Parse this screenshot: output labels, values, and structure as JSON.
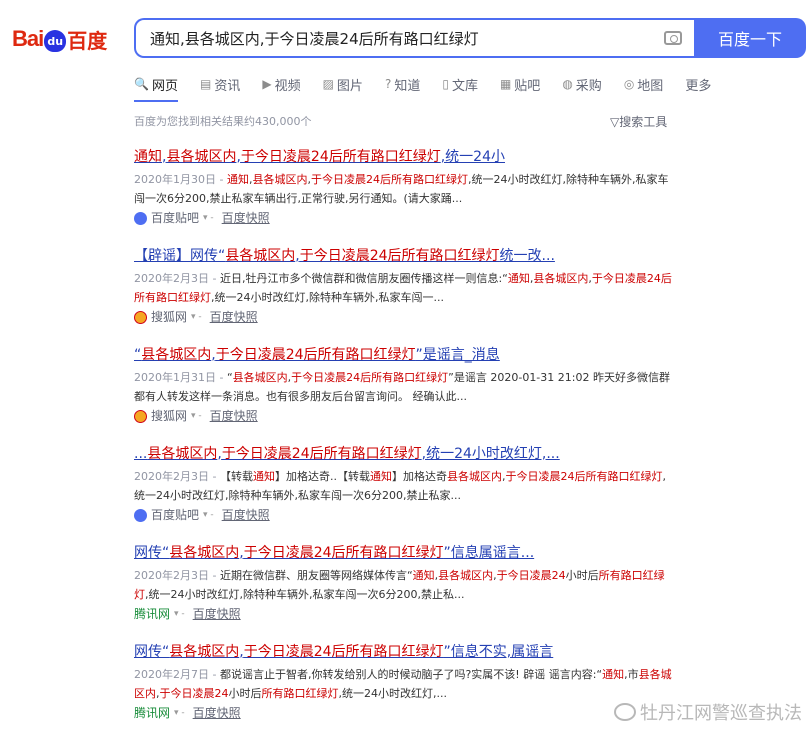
{
  "logo": {
    "latin": "Bai",
    "paw": "du",
    "chinese": "百度"
  },
  "search": {
    "query": "通知,县各城区内,于今日凌晨24后所有路口红绿灯",
    "button": "百度一下"
  },
  "tabs": [
    {
      "icon": "🔍",
      "label": "网页"
    },
    {
      "icon": "▤",
      "label": "资讯"
    },
    {
      "icon": "▶",
      "label": "视频"
    },
    {
      "icon": "▨",
      "label": "图片"
    },
    {
      "icon": "?",
      "label": "知道"
    },
    {
      "icon": "▯",
      "label": "文库"
    },
    {
      "icon": "▦",
      "label": "贴吧"
    },
    {
      "icon": "◍",
      "label": "采购"
    },
    {
      "icon": "◎",
      "label": "地图"
    },
    {
      "icon": "",
      "label": "更多"
    }
  ],
  "result_count": "百度为您找到相关结果约430,000个",
  "tools": "▽搜索工具",
  "snapshot_label": "百度快照",
  "results": [
    {
      "title": "<span class=\"hl\">通知</span>,<span class=\"hl\">县各城区内</span>,<span class=\"hl\">于今日凌晨24后所有路口红绿灯</span>,统一24小",
      "abstract": "<span class=\"date\">2020年1月30日 - </span><span class=\"hl\">通知</span>,<span class=\"hl\">县各城区内</span>,<span class=\"hl\">于今日凌晨24后所有路口红绿灯</span>,统一24小时改红灯,除特种车辆外,私家车闯一次6分200,禁止私家车辆出行,正常行驶,另行通知。(请大家踊...",
      "source": "百度贴吧",
      "src_icon": "tieba"
    },
    {
      "title": "【辟谣】网传“<span class=\"hl\">县各城区内</span>,<span class=\"hl\">于今日凌晨24后所有路口红绿灯</span>统一改...",
      "abstract": "<span class=\"date\">2020年2月3日 - </span>近日,牡丹江市多个微信群和微信朋友圈传播这样一则信息:“<span class=\"hl\">通知</span>,<span class=\"hl\">县各城区内</span>,<span class=\"hl\">于今日凌晨24后所有路口红绿灯</span>,统一24小时改红灯,除特种车辆外,私家车闯一...",
      "source": "搜狐网",
      "src_icon": "sohu"
    },
    {
      "title": "“<span class=\"hl\">县各城区内</span>,<span class=\"hl\">于今日凌晨24后所有路口红绿灯</span>”是谣言_消息",
      "abstract": "<span class=\"date\">2020年1月31日 - </span>“<span class=\"hl\">县各城区内</span>,<span class=\"hl\">于今日凌晨24后所有路口红绿灯</span>”是谣言 2020-01-31 21:02 昨天好多微信群都有人转发这样一条消息。也有很多朋友后台留言询问。 经确认此...",
      "source": "搜狐网",
      "src_icon": "sohu"
    },
    {
      "title": "...<span class=\"hl\">县各城区内</span>,<span class=\"hl\">于今日凌晨24后所有路口红绿灯</span>,统一24小时改红灯,...",
      "abstract": "<span class=\"date\">2020年2月3日 - </span>【转载<span class=\"hl\">通知</span>】加格达奇..【转载<span class=\"hl\">通知</span>】加格达奇<span class=\"hl\">县各城区内</span>,<span class=\"hl\">于今日凌晨24后所有路口红绿灯</span>,统一24小时改红灯,除特种车辆外,私家车闯一次6分200,禁止私家...",
      "source": "百度贴吧",
      "src_icon": "tieba"
    },
    {
      "title": "网传“<span class=\"hl\">县各城区内</span>,<span class=\"hl\">于今日凌晨24后所有路口红绿灯</span>”信息属谣言...",
      "abstract": "<span class=\"date\">2020年2月3日 - </span>近期在微信群、朋友圈等网络媒体传言“<span class=\"hl\">通知</span>,<span class=\"hl\">县各城区内</span>,<span class=\"hl\">于今日凌晨24</span>小时后<span class=\"hl\">所有路口红绿灯</span>,统一24小时改红灯,除特种车辆外,私家车闯一次6分200,禁止私...",
      "source": "腾讯网",
      "src_icon": "tencent"
    },
    {
      "title": "网传“<span class=\"hl\">县各城区内</span>,<span class=\"hl\">于今日凌晨24后所有路口红绿灯</span>”信息不实,属谣言",
      "abstract": "<span class=\"date\">2020年2月7日 - </span>都说谣言止于智者,你转发给别人的时候动脑子了吗?实属不该! 辟谣 谣言内容:“<span class=\"hl\">通知</span>,市<span class=\"hl\">县各城区内</span>,<span class=\"hl\">于今日凌晨24</span>小时后<span class=\"hl\">所有路口红绿灯</span>,统一24小时改红灯,...",
      "source": "腾讯网",
      "src_icon": "tencent"
    }
  ],
  "watermark": "牡丹江网警巡查执法"
}
